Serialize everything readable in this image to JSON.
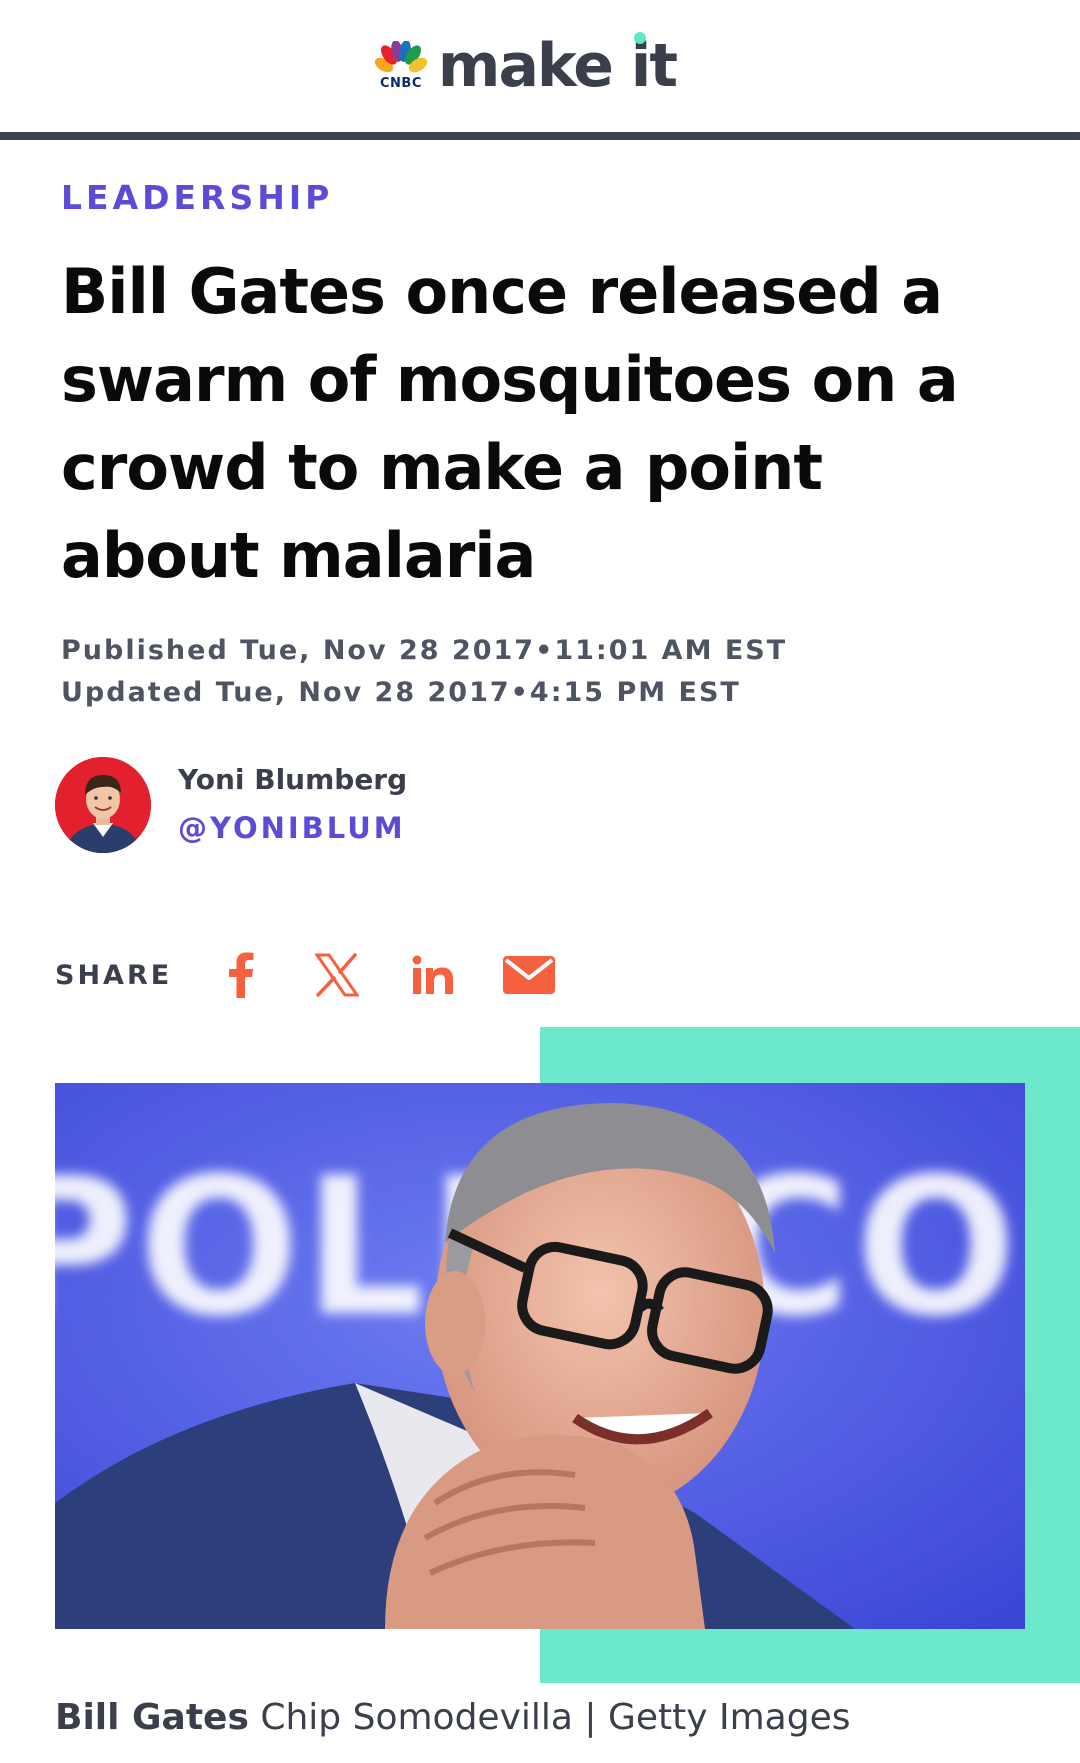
{
  "header": {
    "logo_small": "CNBC",
    "logo_wordmark": "make it"
  },
  "article": {
    "kicker": "LEADERSHIP",
    "headline": "Bill Gates once released a swarm of mosquitoes on a crowd to make a point about malaria",
    "published": "Published Tue, Nov 28 2017•11:01 AM EST",
    "updated": "Updated Tue, Nov 28 2017•4:15 PM EST"
  },
  "author": {
    "name": "Yoni Blumberg",
    "handle": "@YONIBLUM"
  },
  "share": {
    "label": "SHARE",
    "icons": [
      "facebook-icon",
      "x-icon",
      "linkedin-icon",
      "email-icon"
    ]
  },
  "image": {
    "background_text": "POLITICO",
    "caption_subject": "Bill Gates",
    "caption_credit": "Chip Somodevilla | Getty Images"
  },
  "colors": {
    "accent_purple": "#5b4bd6",
    "share_orange": "#f5603f",
    "teal": "#6ce8cb",
    "header_rule": "#3d434f"
  }
}
